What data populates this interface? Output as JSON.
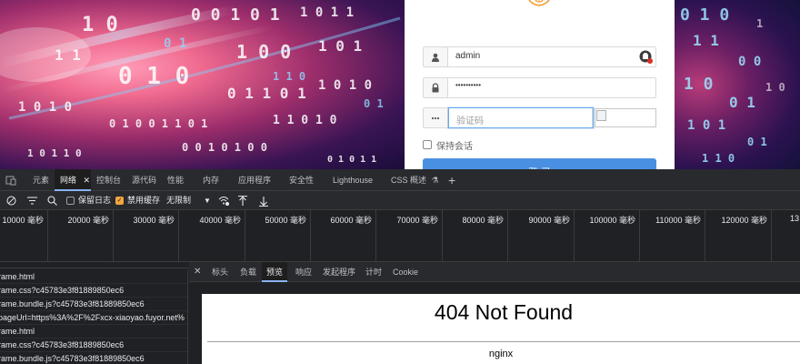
{
  "login": {
    "username_value": "admin",
    "password_masked": "••••••••••",
    "captcha_placeholder": "验证码",
    "remember_label": "保持会话",
    "login_button": "登 录"
  },
  "devtools": {
    "main_tabs": [
      "元素",
      "网络",
      "控制台",
      "源代码",
      "性能",
      "内存",
      "应用程序",
      "安全性",
      "Lighthouse",
      "CSS 概述"
    ],
    "toolbar": {
      "preserve_log": "保留日志",
      "disable_cache": "禁用缓存",
      "throttling": "无限制"
    },
    "timeline_ticks": [
      "10000 毫秒",
      "20000 毫秒",
      "30000 毫秒",
      "40000 毫秒",
      "50000 毫秒",
      "60000 毫秒",
      "70000 毫秒",
      "80000 毫秒",
      "90000 毫秒",
      "100000 毫秒",
      "110000 毫秒",
      "120000 毫秒",
      "13"
    ],
    "requests": [
      "rame.html",
      "rame.css?c45783e3f81889850ec6",
      "rame.bundle.js?c45783e3f81889850ec6",
      "pageUrl=https%3A%2F%2Fxcx-xiaoyao.fuyor.net%",
      "rame.html",
      "rame.css?c45783e3f81889850ec6",
      "rame.bundle.js?c45783e3f81889850ec6"
    ],
    "detail_tabs": [
      "标头",
      "负载",
      "预览",
      "响应",
      "发起程序",
      "计时",
      "Cookie"
    ],
    "preview": {
      "title": "404 Not Found",
      "server": "nginx"
    }
  },
  "colors": {
    "accent": "#8ab4f8",
    "login_button": "#4a90e2",
    "checked": "#f2a640"
  }
}
